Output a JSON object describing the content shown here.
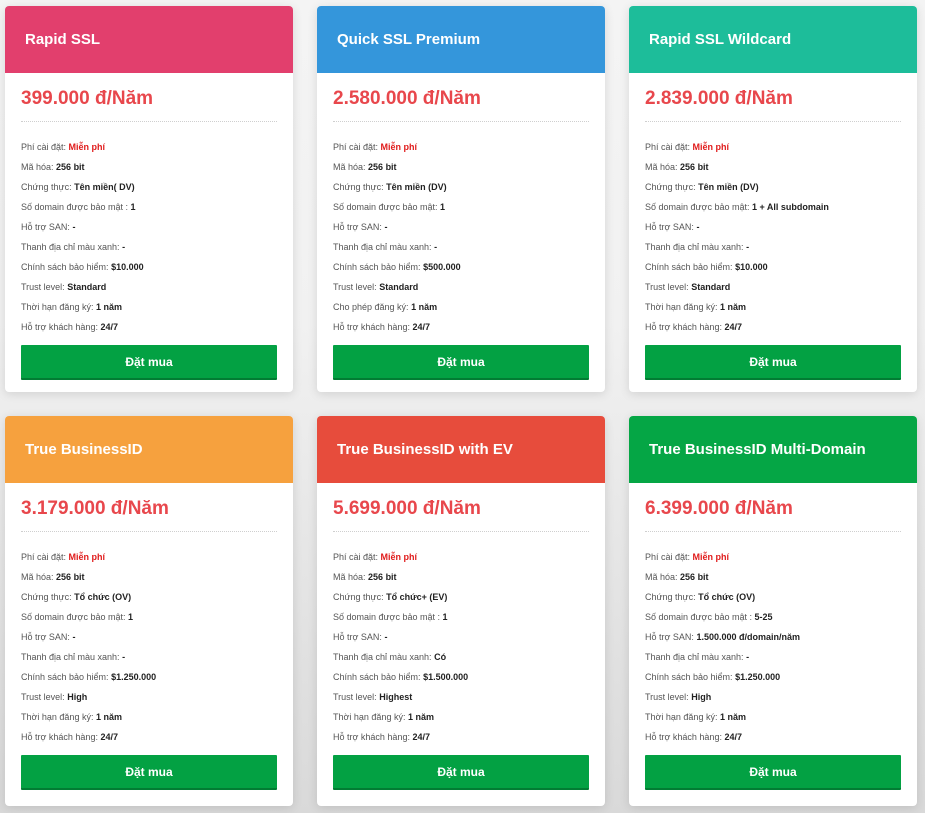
{
  "colors": {
    "card_pink": "#e23f6d",
    "card_blue": "#3496db",
    "card_teal": "#1dbd9a",
    "card_orange": "#f6a13e",
    "card_red": "#e74c3c",
    "card_green": "#05a645",
    "price": "#e8474c",
    "free_text": "#e01b1b",
    "button": "#03a143"
  },
  "cards": [
    {
      "title": "Rapid SSL",
      "price": "399.000 đ/Năm",
      "features": [
        {
          "label": "Phí cài đặt:",
          "value": "Miễn phí"
        },
        {
          "label": "Mã hóa:",
          "value": "256 bit"
        },
        {
          "label": "Chứng thực:",
          "value": "Tên miền( DV)"
        },
        {
          "label": "Số domain được bảo mật :",
          "value": "1"
        },
        {
          "label": "Hỗ trợ SAN:",
          "value": "-"
        },
        {
          "label": "Thanh địa chỉ màu xanh:",
          "value": "-"
        },
        {
          "label": "Chính sách bảo hiểm:",
          "value": "$10.000"
        },
        {
          "label": "Trust level:",
          "value": "Standard"
        },
        {
          "label": "Thời hạn đăng ký:",
          "value": "1 năm"
        },
        {
          "label": "Hỗ trợ khách hàng:",
          "value": "24/7"
        }
      ],
      "button": "Đặt mua"
    },
    {
      "title": "Quick SSL Premium",
      "price": "2.580.000 đ/Năm",
      "features": [
        {
          "label": "Phí cài đặt:",
          "value": "Miễn phí"
        },
        {
          "label": "Mã hóa:",
          "value": "256 bit"
        },
        {
          "label": "Chứng thực:",
          "value": "Tên miền (DV)"
        },
        {
          "label": "Số domain được bảo mật:",
          "value": "1"
        },
        {
          "label": "Hỗ trợ SAN:",
          "value": "-"
        },
        {
          "label": "Thanh địa chỉ màu xanh:",
          "value": "-"
        },
        {
          "label": "Chính sách bảo hiểm:",
          "value": "$500.000"
        },
        {
          "label": "Trust level:",
          "value": "Standard"
        },
        {
          "label": "Cho phép đăng ký:",
          "value": "1 năm"
        },
        {
          "label": "Hỗ trợ khách hàng:",
          "value": "24/7"
        }
      ],
      "button": "Đặt mua"
    },
    {
      "title": "Rapid SSL Wildcard",
      "price": "2.839.000 đ/Năm",
      "features": [
        {
          "label": "Phí cài đặt:",
          "value": "Miễn phí"
        },
        {
          "label": "Mã hóa:",
          "value": "256 bit"
        },
        {
          "label": "Chứng thực:",
          "value": "Tên miền (DV)"
        },
        {
          "label": "Số domain được bảo mật:",
          "value": "1 + All subdomain"
        },
        {
          "label": "Hỗ trợ SAN:",
          "value": "-"
        },
        {
          "label": "Thanh địa chỉ màu xanh:",
          "value": "-"
        },
        {
          "label": "Chính sách bảo hiểm:",
          "value": "$10.000"
        },
        {
          "label": "Trust level:",
          "value": "Standard"
        },
        {
          "label": "Thời hạn đăng ký:",
          "value": "1 năm"
        },
        {
          "label": "Hỗ trợ khách hàng:",
          "value": "24/7"
        }
      ],
      "button": "Đặt mua"
    },
    {
      "title": "True BusinessID",
      "price": "3.179.000 đ/Năm",
      "features": [
        {
          "label": "Phí cài đặt:",
          "value": "Miễn phí"
        },
        {
          "label": "Mã hóa:",
          "value": "256 bit"
        },
        {
          "label": "Chứng thực:",
          "value": "Tổ chức (OV)"
        },
        {
          "label": "Số domain được bảo mật:",
          "value": "1"
        },
        {
          "label": "Hỗ trợ SAN:",
          "value": "-"
        },
        {
          "label": "Thanh địa chỉ màu xanh:",
          "value": "-"
        },
        {
          "label": "Chính sách bảo hiểm:",
          "value": "$1.250.000"
        },
        {
          "label": "Trust level:",
          "value": "High"
        },
        {
          "label": "Thời hạn đăng ký:",
          "value": "1 năm"
        },
        {
          "label": "Hỗ trợ khách hàng:",
          "value": "24/7"
        }
      ],
      "button": "Đặt mua"
    },
    {
      "title": "True BusinessID with EV",
      "price": "5.699.000 đ/Năm",
      "features": [
        {
          "label": "Phí cài đặt:",
          "value": "Miễn phí"
        },
        {
          "label": "Mã hóa:",
          "value": "256 bit"
        },
        {
          "label": "Chứng thực:",
          "value": "Tổ chức+ (EV)"
        },
        {
          "label": "Số domain được bảo mật :",
          "value": "1"
        },
        {
          "label": "Hỗ trợ SAN:",
          "value": "-"
        },
        {
          "label": "Thanh địa chỉ màu xanh:",
          "value": "Có"
        },
        {
          "label": "Chính sách bảo hiểm:",
          "value": "$1.500.000"
        },
        {
          "label": "Trust level:",
          "value": "Highest"
        },
        {
          "label": "Thời hạn đăng ký:",
          "value": "1 năm"
        },
        {
          "label": "Hỗ trợ khách hàng:",
          "value": "24/7"
        }
      ],
      "button": "Đặt mua"
    },
    {
      "title": "True BusinessID Multi-Domain",
      "price": "6.399.000 đ/Năm",
      "features": [
        {
          "label": "Phí cài đặt:",
          "value": "Miễn phí"
        },
        {
          "label": "Mã hóa:",
          "value": "256 bit"
        },
        {
          "label": "Chứng thực:",
          "value": "Tổ chức (OV)"
        },
        {
          "label": "Số domain được bảo mật :",
          "value": "5-25"
        },
        {
          "label": "Hỗ trợ SAN:",
          "value": "1.500.000 đ/domain/năm"
        },
        {
          "label": "Thanh địa chỉ màu xanh:",
          "value": "-"
        },
        {
          "label": "Chính sách bảo hiểm:",
          "value": "$1.250.000"
        },
        {
          "label": "Trust level:",
          "value": "High"
        },
        {
          "label": "Thời hạn đăng ký:",
          "value": "1 năm"
        },
        {
          "label": "Hỗ trợ khách hàng:",
          "value": "24/7"
        }
      ],
      "button": "Đặt mua"
    }
  ]
}
